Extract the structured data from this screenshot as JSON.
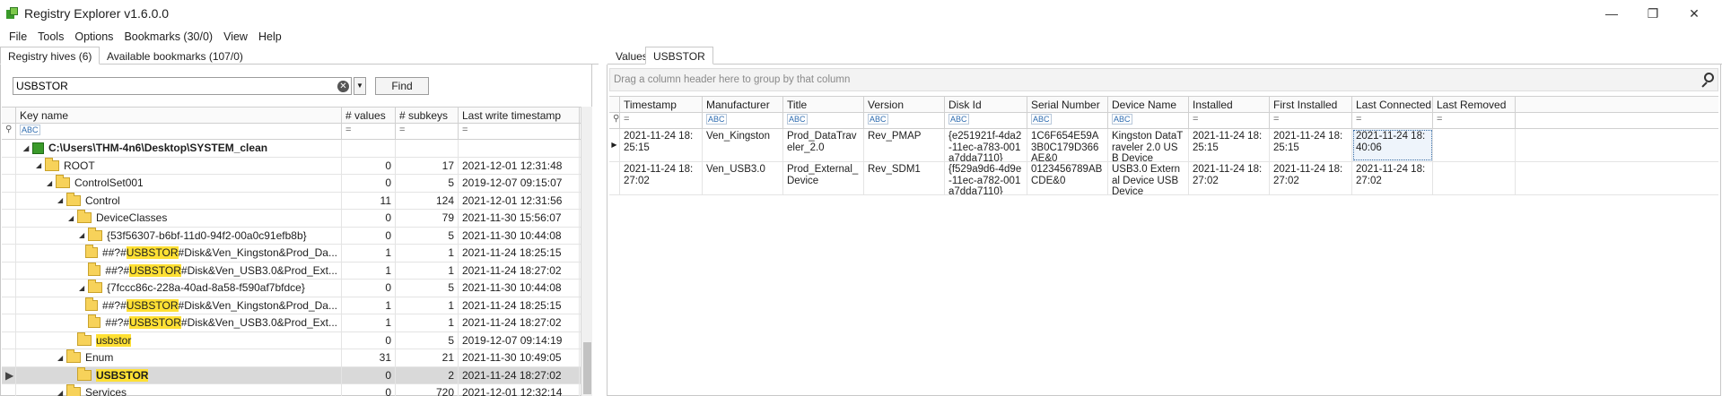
{
  "window": {
    "title": "Registry Explorer v1.6.0.0",
    "minimize_glyph": "—",
    "maximize_glyph": "❐",
    "close_glyph": "✕"
  },
  "menu": [
    "File",
    "Tools",
    "Options",
    "Bookmarks (30/0)",
    "View",
    "Help"
  ],
  "left": {
    "tabs": [
      "Registry hives (6)",
      "Available bookmarks (107/0)"
    ],
    "search": {
      "value": "USBSTOR",
      "clear_glyph": "✕",
      "dropdown_glyph": "▼",
      "find_label": "Find"
    },
    "columns": [
      "Key name",
      "# values",
      "# subkeys",
      "Last write timestamp"
    ],
    "filter_abc": "ABC",
    "filter_eq": "=",
    "rows": [
      {
        "pre": "",
        "hl": "",
        "post": "C:\\Users\\THM-4n6\\Desktop\\SYSTEM_clean",
        "values": "",
        "subkeys": "",
        "ts": "",
        "exp": "◢",
        "icon": "hive",
        "bold": true
      },
      {
        "pre": "ROOT",
        "hl": "",
        "post": "",
        "values": "0",
        "subkeys": "17",
        "ts": "2021-12-01 12:31:48",
        "exp": "◢",
        "icon": "folder"
      },
      {
        "pre": "ControlSet001",
        "hl": "",
        "post": "",
        "values": "0",
        "subkeys": "5",
        "ts": "2019-12-07 09:15:07",
        "exp": "◢",
        "icon": "folder"
      },
      {
        "pre": "Control",
        "hl": "",
        "post": "",
        "values": "11",
        "subkeys": "124",
        "ts": "2021-12-01 12:31:56",
        "exp": "◢",
        "icon": "folder"
      },
      {
        "pre": "DeviceClasses",
        "hl": "",
        "post": "",
        "values": "0",
        "subkeys": "79",
        "ts": "2021-11-30 15:56:07",
        "exp": "◢",
        "icon": "folder"
      },
      {
        "pre": "{53f56307-b6bf-11d0-94f2-00a0c91efb8b}",
        "hl": "",
        "post": "",
        "values": "0",
        "subkeys": "5",
        "ts": "2021-11-30 10:44:08",
        "exp": "◢",
        "icon": "folder"
      },
      {
        "pre": "##?#",
        "hl": "USBSTOR",
        "post": "#Disk&Ven_Kingston&Prod_Da...",
        "values": "1",
        "subkeys": "1",
        "ts": "2021-11-24 18:25:15",
        "exp": "",
        "icon": "folder"
      },
      {
        "pre": "##?#",
        "hl": "USBSTOR",
        "post": "#Disk&Ven_USB3.0&Prod_Ext...",
        "values": "1",
        "subkeys": "1",
        "ts": "2021-11-24 18:27:02",
        "exp": "",
        "icon": "folder"
      },
      {
        "pre": "{7fccc86c-228a-40ad-8a58-f590af7bfdce}",
        "hl": "",
        "post": "",
        "values": "0",
        "subkeys": "5",
        "ts": "2021-11-30 10:44:08",
        "exp": "◢",
        "icon": "folder"
      },
      {
        "pre": "##?#",
        "hl": "USBSTOR",
        "post": "#Disk&Ven_Kingston&Prod_Da...",
        "values": "1",
        "subkeys": "1",
        "ts": "2021-11-24 18:25:15",
        "exp": "",
        "icon": "folder"
      },
      {
        "pre": "##?#",
        "hl": "USBSTOR",
        "post": "#Disk&Ven_USB3.0&Prod_Ext...",
        "values": "1",
        "subkeys": "1",
        "ts": "2021-11-24 18:27:02",
        "exp": "",
        "icon": "folder"
      },
      {
        "pre": "",
        "hl": "usbstor",
        "post": "",
        "values": "0",
        "subkeys": "5",
        "ts": "2019-12-07 09:14:19",
        "exp": "",
        "icon": "folder"
      },
      {
        "pre": "Enum",
        "hl": "",
        "post": "",
        "values": "31",
        "subkeys": "21",
        "ts": "2021-11-30 10:49:05",
        "exp": "◢",
        "icon": "folder"
      },
      {
        "pre": "",
        "hl": "USBSTOR",
        "post": "",
        "values": "0",
        "subkeys": "2",
        "ts": "2021-11-24 18:27:02",
        "exp": "",
        "icon": "folder",
        "selected": true,
        "bold": true
      },
      {
        "pre": "Services",
        "hl": "",
        "post": "",
        "values": "0",
        "subkeys": "720",
        "ts": "2021-12-01 12:32:14",
        "exp": "◢",
        "icon": "folder"
      }
    ],
    "current_row_marker": "▶"
  },
  "right": {
    "tabs": [
      "Values",
      "USBSTOR"
    ],
    "group_hint": "Drag a column header here to group by that column",
    "columns": [
      "Timestamp",
      "Manufacturer",
      "Title",
      "Version",
      "Disk Id",
      "Serial Number",
      "Device Name",
      "Installed",
      "First Installed",
      "Last Connected",
      "Last Removed"
    ],
    "filter_types": [
      "eq",
      "abc",
      "abc",
      "abc",
      "abc",
      "abc",
      "abc",
      "eq",
      "eq",
      "eq",
      "eq"
    ],
    "rows": [
      [
        "2021-11-24 18:25:15",
        "Ven_Kingston",
        "Prod_DataTraveler_2.0",
        "Rev_PMAP",
        "{e251921f-4da2-11ec-a783-001a7dda7110}",
        "1C6F654E59A3B0C179D366AE&0",
        "Kingston DataTraveler 2.0 USB Device",
        "2021-11-24 18:25:15",
        "2021-11-24 18:25:15",
        "2021-11-24 18:40:06",
        ""
      ],
      [
        "2021-11-24 18:27:02",
        "Ven_USB3.0",
        "Prod_External_Device",
        "Rev_SDM1",
        "{f529a9d6-4d9e-11ec-a782-001a7dda7110}",
        "0123456789ABCDE&0",
        "USB3.0 External Device USB Device",
        "2021-11-24 18:27:02",
        "2021-11-24 18:27:02",
        "2021-11-24 18:27:02",
        ""
      ]
    ],
    "current_row_marker": "▶"
  }
}
